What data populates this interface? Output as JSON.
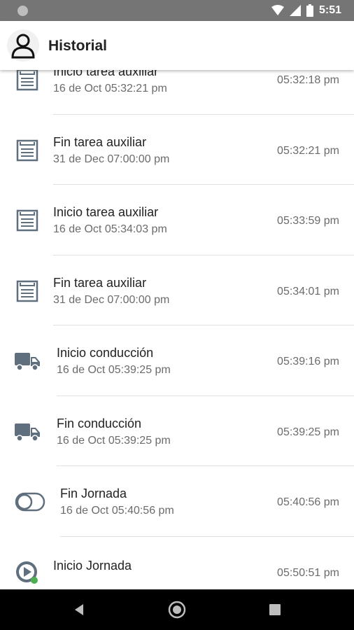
{
  "status_bar": {
    "time": "5:51"
  },
  "header": {
    "title": "Historial"
  },
  "items": [
    {
      "title": "Inicio tarea auxiliar",
      "subtitle": "16 de Oct 05:32:21 pm",
      "time": "05:32:18 pm",
      "icon": "task-list-icon"
    },
    {
      "title": "Fin tarea auxiliar",
      "subtitle": "31 de Dec 07:00:00 pm",
      "time": "05:32:21 pm",
      "icon": "task-list-icon"
    },
    {
      "title": "Inicio tarea auxiliar",
      "subtitle": "16 de Oct 05:34:03 pm",
      "time": "05:33:59 pm",
      "icon": "task-list-icon"
    },
    {
      "title": "Fin tarea auxiliar",
      "subtitle": "31 de Dec 07:00:00 pm",
      "time": "05:34:01 pm",
      "icon": "task-list-icon"
    },
    {
      "title": "Inicio conducción",
      "subtitle": "16 de Oct 05:39:25 pm",
      "time": "05:39:16 pm",
      "icon": "truck-icon"
    },
    {
      "title": "Fin conducción",
      "subtitle": "16 de Oct 05:39:25 pm",
      "time": "05:39:25 pm",
      "icon": "truck-icon"
    },
    {
      "title": "Fin Jornada",
      "subtitle": "16 de Oct 05:40:56 pm",
      "time": "05:40:56 pm",
      "icon": "toggle-off-icon"
    },
    {
      "title": "Inicio Jornada",
      "subtitle": "",
      "time": "05:50:51 pm",
      "icon": "play-icon"
    }
  ],
  "colors": {
    "icon": "#5f6f7d",
    "accent_green": "#4caf50",
    "divider": "#e0e0e0"
  }
}
